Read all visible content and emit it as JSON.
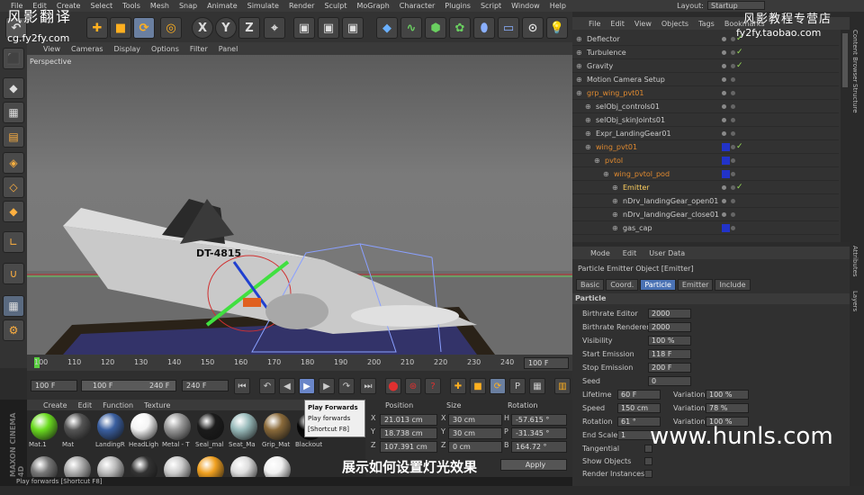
{
  "menus": [
    "File",
    "Edit",
    "Create",
    "Select",
    "Tools",
    "Mesh",
    "Snap",
    "Animate",
    "Simulate",
    "Render",
    "Sculpt",
    "MoGraph",
    "Character",
    "Plugins",
    "Script",
    "Window",
    "Help"
  ],
  "layout": {
    "label": "Layout:",
    "value": "Startup"
  },
  "watermarks": {
    "top_left": "风影翻译",
    "url": "cg.fy2fy.com",
    "top_right": "风影教程专营店",
    "taobao": "fy2fy.taobao.com",
    "hunls": "www.hunls.com",
    "subtitle": "展示如何设置灯光效果"
  },
  "viewport": {
    "menu": [
      "View",
      "Cameras",
      "Display",
      "Options",
      "Filter",
      "Panel"
    ],
    "label": "Perspective",
    "model_text": "DT-4815"
  },
  "timeline": {
    "ticks": [
      "100",
      "110",
      "120",
      "130",
      "140",
      "150",
      "160",
      "170",
      "180",
      "190",
      "200",
      "210",
      "220",
      "230",
      "240"
    ],
    "end_field": "100 F"
  },
  "transport": {
    "start": "100 F",
    "min": "100 F",
    "max": "240 F",
    "end": "240 F"
  },
  "materials": {
    "menu": [
      "Create",
      "Edit",
      "Function",
      "Texture"
    ],
    "row1": [
      {
        "name": "Mat.1",
        "color": "#6bdc20"
      },
      {
        "name": "Mat",
        "color": "#555"
      },
      {
        "name": "LandingR",
        "color": "#3a5fa0"
      },
      {
        "name": "HeadLigh",
        "color": "#f4f4f4"
      },
      {
        "name": "Metal - T",
        "color": "#999"
      },
      {
        "name": "Seal_mal",
        "color": "#1b1b1b"
      },
      {
        "name": "Seat_Ma",
        "color": "#9bb"
      },
      {
        "name": "Grip_Mat",
        "color": "#8a6a3a"
      },
      {
        "name": "Blackout",
        "color": "#050505"
      }
    ],
    "row2": [
      {
        "name": "",
        "color": "#777"
      },
      {
        "name": "",
        "color": "#aaa"
      },
      {
        "name": "",
        "color": "#bbb"
      },
      {
        "name": "",
        "color": "#333"
      },
      {
        "name": "",
        "color": "#ccc"
      },
      {
        "name": "",
        "color": "#f0a020"
      },
      {
        "name": "",
        "color": "#ddd"
      },
      {
        "name": "",
        "color": "#f0f0f0"
      }
    ]
  },
  "tooltip": {
    "title": "Play Forwards",
    "line1": "Play forwards",
    "line2": "[Shortcut F8]"
  },
  "coords": {
    "headers": [
      "Position",
      "Size",
      "Rotation"
    ],
    "rows": [
      {
        "a": "X",
        "pos": "21.013 cm",
        "b": "X",
        "size": "30 cm",
        "c": "H",
        "rot": "-57.615 °"
      },
      {
        "a": "Y",
        "pos": "18.738 cm",
        "b": "Y",
        "size": "30 cm",
        "c": "P",
        "rot": "-31.345 °"
      },
      {
        "a": "Z",
        "pos": "107.391 cm",
        "b": "Z",
        "size": "0 cm",
        "c": "B",
        "rot": "164.72 °"
      }
    ],
    "apply": "Apply"
  },
  "status": "Play forwards [Shortcut F8]",
  "objects": {
    "menu": [
      "File",
      "Edit",
      "View",
      "Objects",
      "Tags",
      "Bookmarks"
    ],
    "rows": [
      {
        "name": "Deflector",
        "indent": 0,
        "color": "#ccc",
        "check": "✓"
      },
      {
        "name": "Turbulence",
        "indent": 0,
        "color": "#ccc",
        "check": "✓"
      },
      {
        "name": "Gravity",
        "indent": 0,
        "color": "#ccc",
        "check": "✓"
      },
      {
        "name": "Motion Camera Setup",
        "indent": 0,
        "color": "#ccc",
        "check": ""
      },
      {
        "name": "grp_wing_pvt01",
        "indent": 0,
        "color": "#e08a30",
        "check": ""
      },
      {
        "name": "selObj_controls01",
        "indent": 1,
        "color": "#ccc",
        "check": ""
      },
      {
        "name": "selObj_skinJoints01",
        "indent": 1,
        "color": "#ccc",
        "check": ""
      },
      {
        "name": "Expr_LandingGear01",
        "indent": 1,
        "color": "#ccc",
        "check": ""
      },
      {
        "name": "wing_pvt01",
        "indent": 1,
        "color": "#e08a30",
        "check": "✓"
      },
      {
        "name": "pvtol",
        "indent": 2,
        "color": "#e08a30",
        "check": ""
      },
      {
        "name": "wing_pvtol_pod",
        "indent": 3,
        "color": "#e08a30",
        "check": ""
      },
      {
        "name": "Emitter",
        "indent": 4,
        "color": "#ffd060",
        "check": "✓"
      },
      {
        "name": "nDrv_landingGear_open01",
        "indent": 4,
        "color": "#ccc",
        "check": ""
      },
      {
        "name": "nDrv_landingGear_close01",
        "indent": 4,
        "color": "#ccc",
        "check": ""
      },
      {
        "name": "gas_cap",
        "indent": 4,
        "color": "#ccc",
        "check": ""
      }
    ]
  },
  "attributes": {
    "menu": [
      "Mode",
      "Edit",
      "User Data"
    ],
    "title": "Particle Emitter Object [Emitter]",
    "tabs": [
      "Basic",
      "Coord.",
      "Particle",
      "Emitter",
      "Include"
    ],
    "section": "Particle",
    "props": [
      {
        "label": "Birthrate Editor",
        "value": "2000"
      },
      {
        "label": "Birthrate Renderer",
        "value": "2000"
      },
      {
        "label": "Visibility",
        "value": "100 %"
      },
      {
        "label": "Start Emission",
        "value": "118 F"
      },
      {
        "label": "Stop Emission",
        "value": "200 F"
      },
      {
        "label": "Seed",
        "value": "0"
      }
    ],
    "pairs": [
      {
        "label": "Lifetime",
        "value": "60 F",
        "vlabel": "Variation",
        "vvalue": "100 %"
      },
      {
        "label": "Speed",
        "value": "150 cm",
        "vlabel": "Variation",
        "vvalue": "78 %"
      },
      {
        "label": "Rotation",
        "value": "61 °",
        "vlabel": "Variation",
        "vvalue": "100 %"
      },
      {
        "label": "End Scale",
        "value": "1",
        "vlabel": "",
        "vvalue": ""
      }
    ],
    "checks": [
      "Tangential",
      "Show Objects",
      "Render Instances"
    ]
  },
  "side_tabs": [
    "Content Browser",
    "Structure",
    "Attributes",
    "Layers"
  ]
}
